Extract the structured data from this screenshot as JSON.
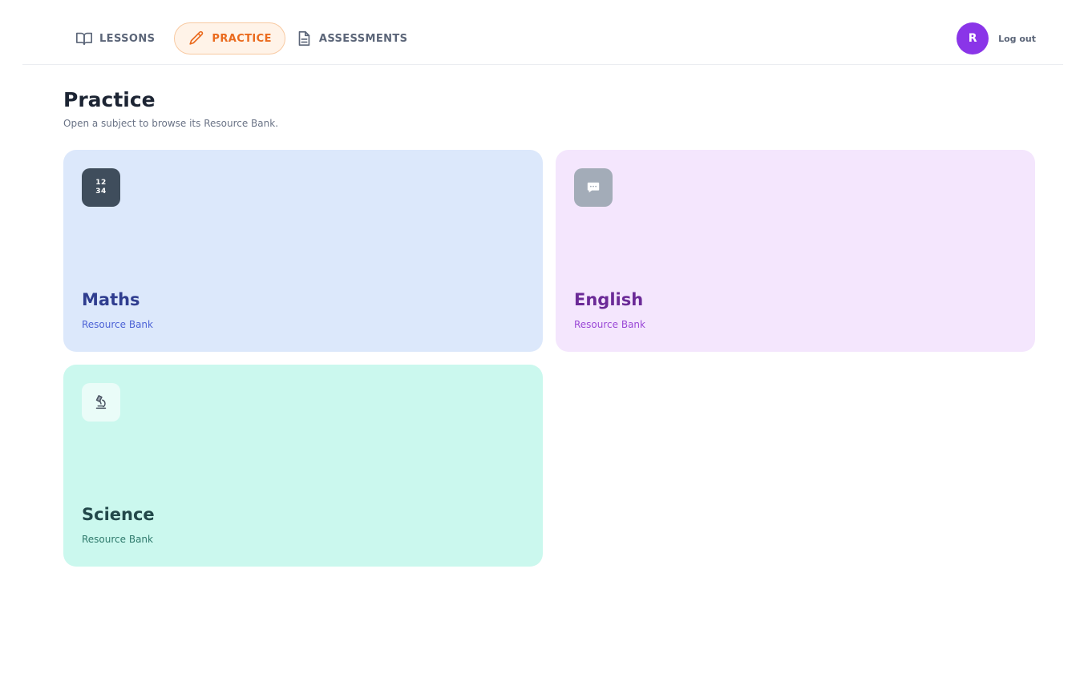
{
  "nav": {
    "items": [
      {
        "label": "LESSONS",
        "icon": "book-icon",
        "active": false
      },
      {
        "label": "PRACTICE",
        "icon": "pencil-icon",
        "active": true
      },
      {
        "label": "ASSESSMENTS",
        "icon": "document-icon",
        "active": false
      }
    ]
  },
  "user": {
    "initial": "R",
    "logout_label": "Log out",
    "avatar_color": "#8a35e8"
  },
  "page": {
    "title": "Practice",
    "subtitle": "Open a subject to browse its Resource Bank."
  },
  "subjects": [
    {
      "name": "Maths",
      "label": "Resource Bank",
      "icon": "numbers-icon",
      "icon_text_top": "12",
      "icon_text_bottom": "34",
      "bg": "#dce8fb",
      "title_color": "#2f3d8f",
      "label_color": "#4d63d6",
      "icon_bg": "#3f4d5c"
    },
    {
      "name": "English",
      "label": "Resource Bank",
      "icon": "speech-bubble-icon",
      "bg": "#f4e6fd",
      "title_color": "#6b2a97",
      "label_color": "#9a48d6",
      "icon_bg": "#a3acb8"
    },
    {
      "name": "Science",
      "label": "Resource Bank",
      "icon": "microscope-icon",
      "bg": "#cbf8ee",
      "title_color": "#22484a",
      "label_color": "#2f7a6c",
      "icon_bg": "#eafcf8"
    }
  ]
}
